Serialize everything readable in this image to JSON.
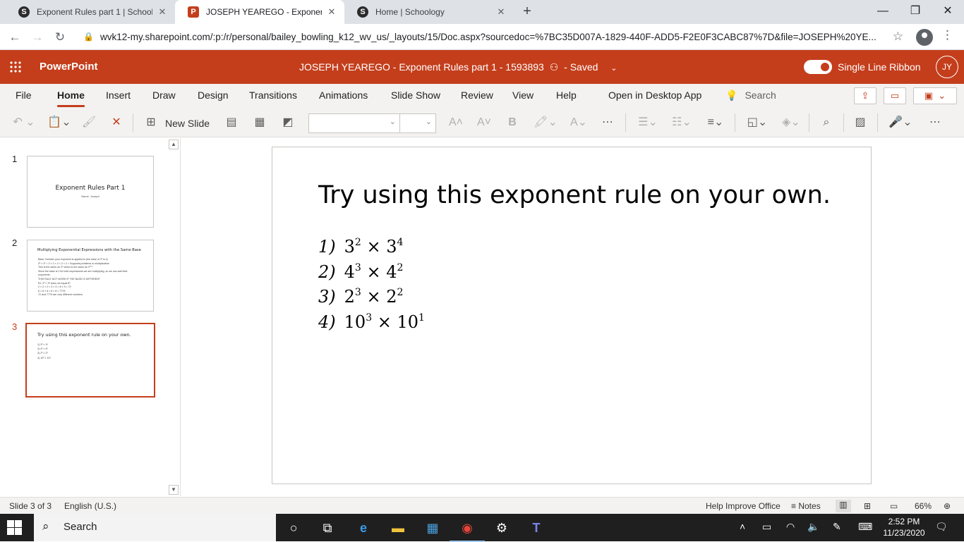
{
  "browser": {
    "tabs": [
      {
        "title": "Exponent Rules part 1 | Schoology",
        "favicon": "schoology-icon"
      },
      {
        "title": "JOSEPH YEAREGO - Exponent Rules part 1 - 1593893",
        "favicon": "powerpoint-icon",
        "active": true
      },
      {
        "title": "Home | Schoology",
        "favicon": "schoology-icon"
      }
    ],
    "url": "wvk12-my.sharepoint.com/:p:/r/personal/bailey_bowling_k12_wv_us/_layouts/15/Doc.aspx?sourcedoc=%7BC35D007A-1829-440F-ADD5-F2E0F3CABC87%7D&file=JOSEPH%20YE..."
  },
  "office": {
    "app_name": "PowerPoint",
    "doc_title": "JOSEPH YEAREGO - Exponent Rules part 1 - 1593893",
    "save_status": "- Saved",
    "ribbon_toggle_label": "Single Line Ribbon",
    "user_initials": "JY",
    "accent": "#c43e1c"
  },
  "ribbon": {
    "tabs": [
      "File",
      "Home",
      "Insert",
      "Draw",
      "Design",
      "Transitions",
      "Animations",
      "Slide Show",
      "Review",
      "View",
      "Help"
    ],
    "open_desktop": "Open in Desktop App",
    "search": "Search",
    "new_slide": "New Slide"
  },
  "thumbnails": {
    "numbers": [
      "1",
      "2",
      "3"
    ],
    "slide1_title": "Exponent Rules Part 1",
    "slide1_sub": "Name: Joseph",
    "slide2_title": "Multiplying Exponential Expressions with the Same Base",
    "slide2_lines": [
      "Base: Number your exponent is applied to (the base of 2³ is 2)",
      "2³ × 2² = 2 × 2 × 2 × 2 × 2 = Supports problems to multiplication",
      "This is the same as 2⁵ which is the same as 2³⁺²",
      "Since the base is 2 for both expressions we are multiplying, so we can add their",
      "exponents.",
      "THIS RULE NOT WORK IF THE BASE IS DIFFERENT",
      "Ex: 2³ × 3² does not equal 6⁵",
      "2 × 2 × 2 × 3 × 3 = 8 × 9 = 72",
      "6 × 6 × 6 × 6 × 6 = 7776",
      "72 and 7776 are very different numbers."
    ],
    "slide3_title": "Try using this exponent rule on your own.",
    "slide3_lines": [
      "1) 3² × 3⁴",
      "2) 4³ × 4²",
      "3) 2³ × 2²",
      "4) 10³ × 10¹"
    ]
  },
  "slide": {
    "title": "Try using this exponent rule on your own.",
    "problems": [
      {
        "num": "1)",
        "b1": "3",
        "e1": "2",
        "op": "×",
        "b2": "3",
        "e2": "4"
      },
      {
        "num": "2)",
        "b1": "4",
        "e1": "3",
        "op": "×",
        "b2": "4",
        "e2": "2"
      },
      {
        "num": "3)",
        "b1": "2",
        "e1": "3",
        "op": "×",
        "b2": "2",
        "e2": "2"
      },
      {
        "num": "4)",
        "b1": "10",
        "e1": "3",
        "op": "×",
        "b2": "10",
        "e2": "1"
      }
    ]
  },
  "status": {
    "slide_count": "Slide 3 of 3",
    "language": "English (U.S.)",
    "help_improve": "Help Improve Office",
    "notes": "Notes",
    "zoom": "66%"
  },
  "taskbar": {
    "search": "Search",
    "time": "2:52 PM",
    "date": "11/23/2020"
  }
}
